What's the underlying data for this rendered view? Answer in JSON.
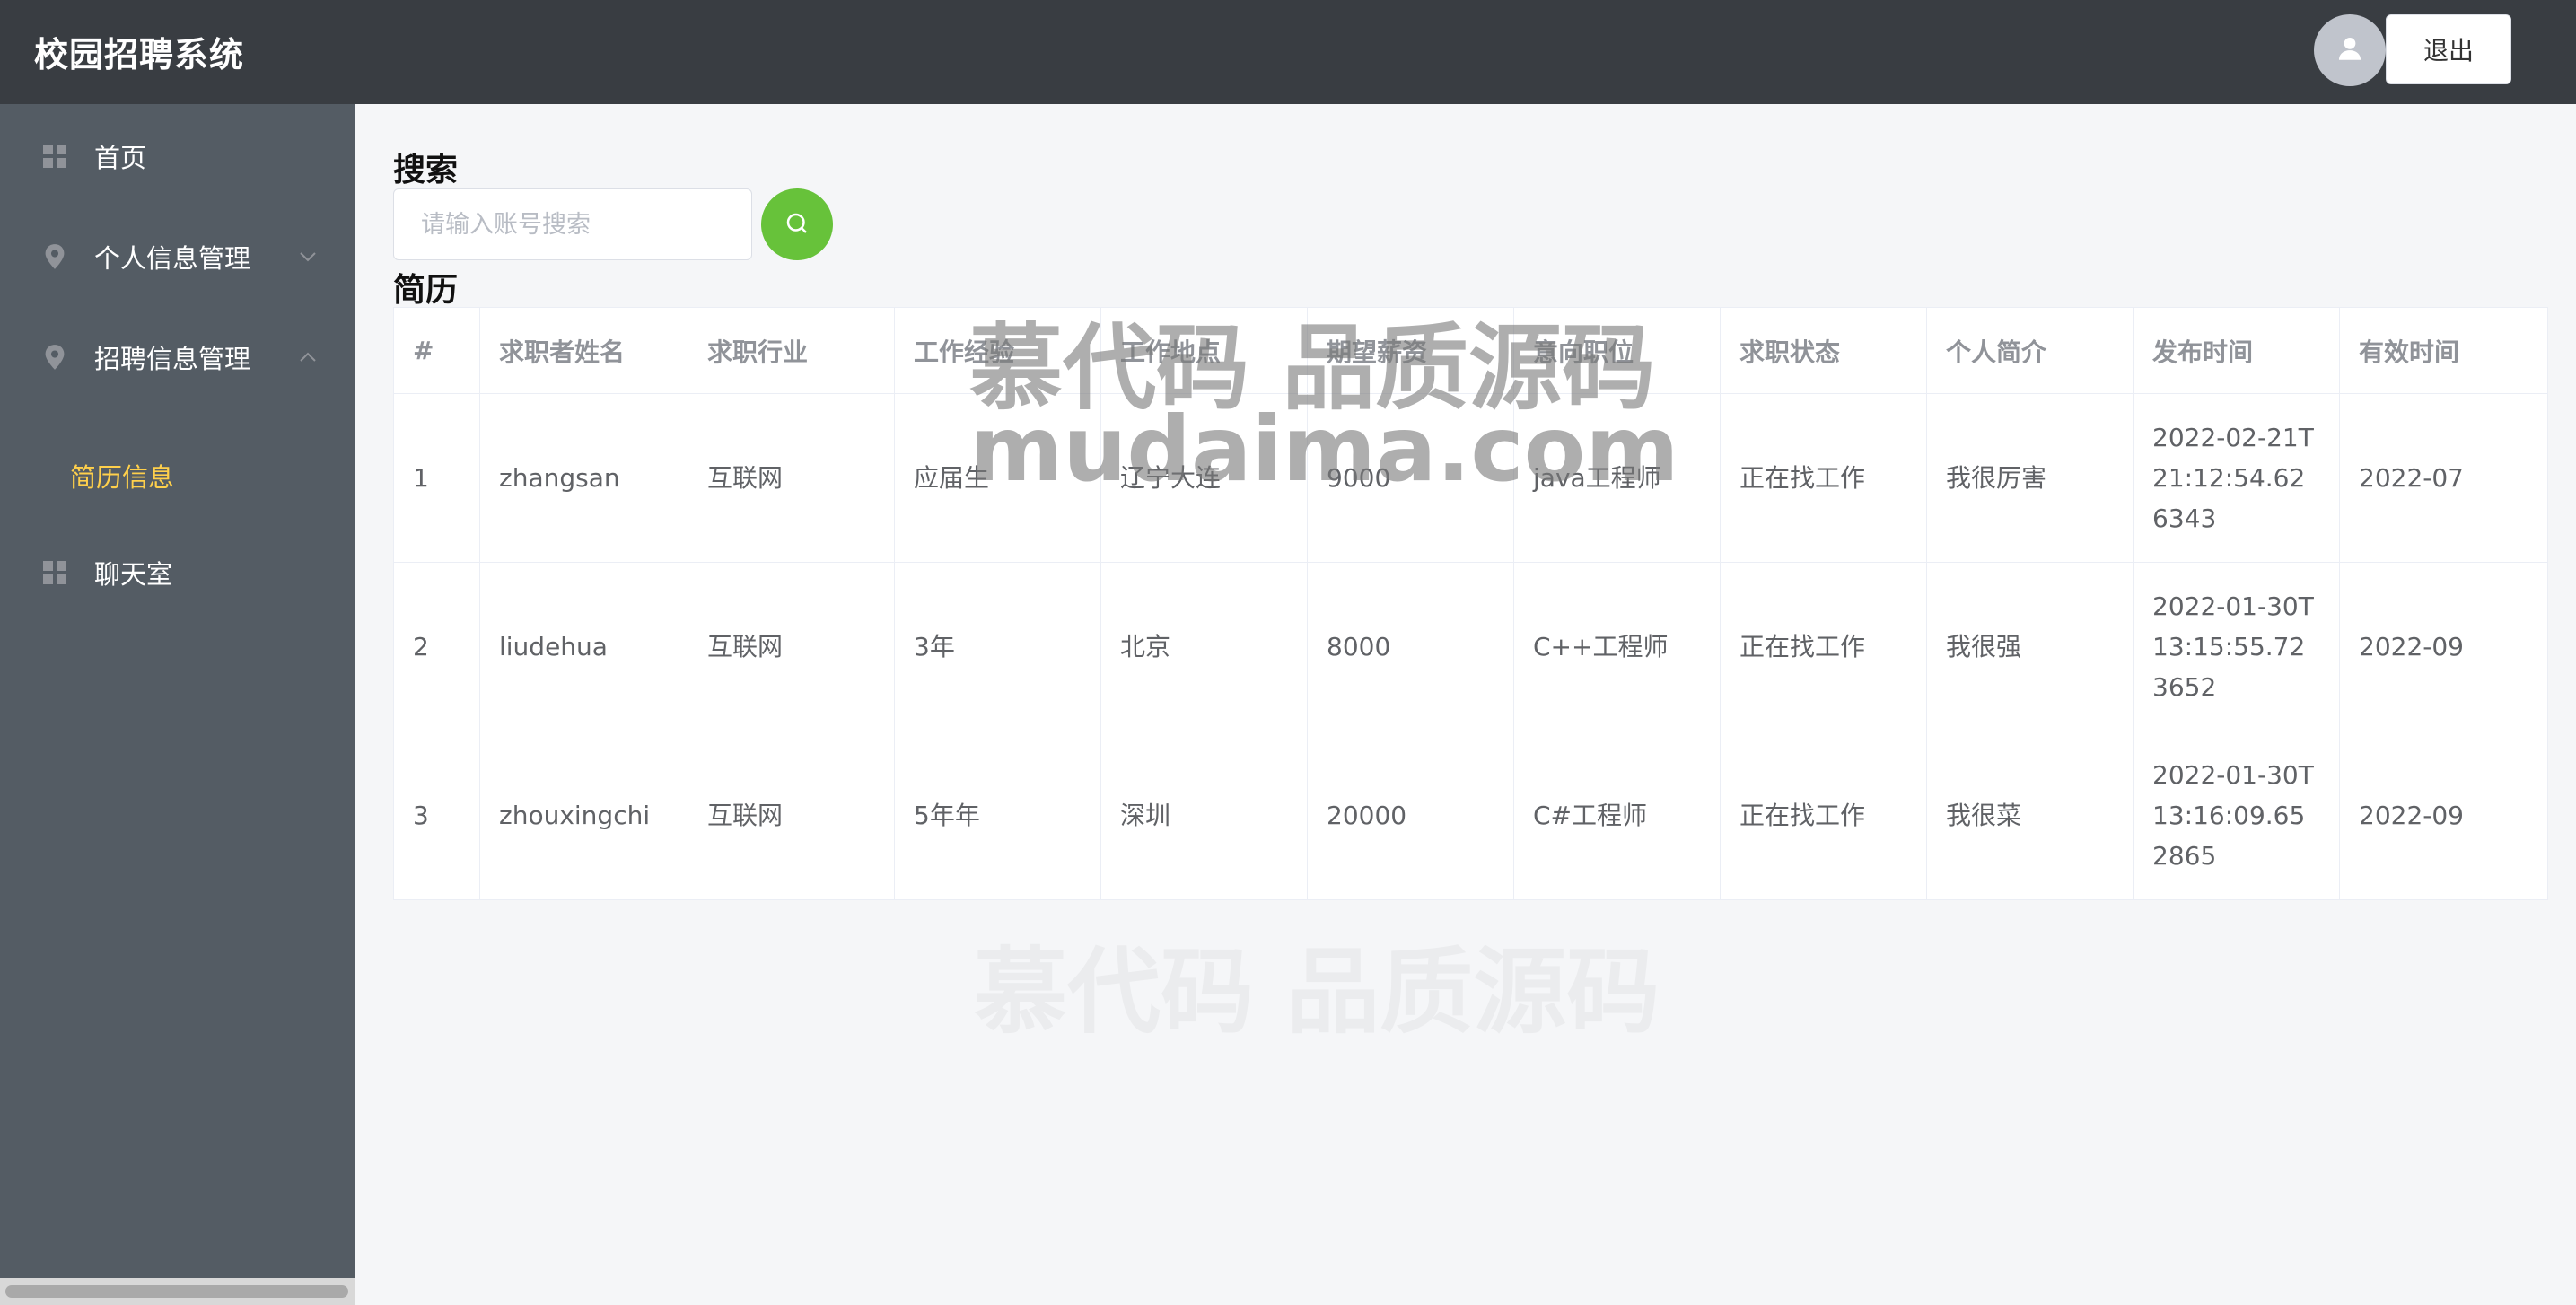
{
  "header": {
    "title": "校园招聘系统",
    "logout_label": "退出"
  },
  "sidebar": {
    "items": [
      {
        "label": "首页",
        "icon": "grid-icon"
      },
      {
        "label": "个人信息管理",
        "icon": "location-icon",
        "arrow": "chevron-down-icon"
      },
      {
        "label": "招聘信息管理",
        "icon": "location-icon",
        "arrow": "chevron-up-icon",
        "expanded": true
      },
      {
        "label": "聊天室",
        "icon": "grid-icon"
      }
    ],
    "submenu": [
      {
        "label": "简历信息",
        "active": true
      }
    ]
  },
  "search": {
    "title": "搜索",
    "placeholder": "请输入账号搜索",
    "button_icon": "search-icon"
  },
  "table": {
    "title": "简历",
    "columns": [
      "#",
      "求职者姓名",
      "求职行业",
      "工作经验",
      "工作地点",
      "期望薪资",
      "意向职位",
      "求职状态",
      "个人简介",
      "发布时间",
      "有效时间"
    ],
    "rows": [
      [
        "1",
        "zhangsan",
        "互联网",
        "应届生",
        "辽宁大连",
        "9000",
        "java工程师",
        "正在找工作",
        "我很厉害",
        "2022-02-21T21:12:54.626343",
        "2022-07"
      ],
      [
        "2",
        "liudehua",
        "互联网",
        "3年",
        "北京",
        "8000",
        "C++工程师",
        "正在找工作",
        "我很强",
        "2022-01-30T13:15:55.723652",
        "2022-09"
      ],
      [
        "3",
        "zhouxingchi",
        "互联网",
        "5年年",
        "深圳",
        "20000",
        "C#工程师",
        "正在找工作",
        "我很菜",
        "2022-01-30T13:16:09.652865",
        "2022-09"
      ]
    ]
  },
  "watermark": {
    "line1": "慕代码 品质源码",
    "line2": "mudaima.com",
    "line3": "慕代码 品质源码"
  },
  "colors": {
    "topbar": "#393d42",
    "sidebar": "#545c64",
    "active": "#ffd04b",
    "search_button": "#67c23a"
  }
}
